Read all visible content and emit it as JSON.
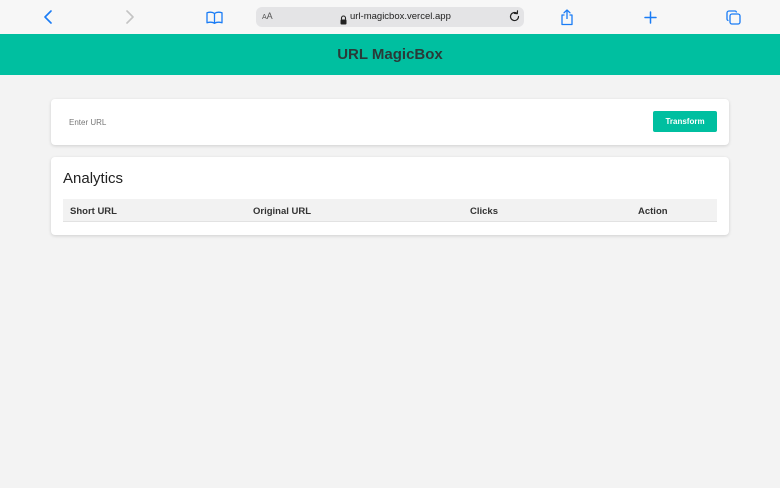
{
  "browser": {
    "aa_label_small": "A",
    "aa_label_large": "A",
    "url": "url-magicbox.vercel.app",
    "icons": [
      "back-icon",
      "forward-icon",
      "bookmarks-icon",
      "lock-icon",
      "reload-icon",
      "share-icon",
      "new-tab-icon",
      "tabs-icon"
    ],
    "accent_color": "#1a7cf5"
  },
  "header": {
    "title": "URL MagicBox",
    "background_color": "#00bfa0"
  },
  "shortener": {
    "input_placeholder": "Enter URL",
    "input_value": "",
    "button_label": "Transform"
  },
  "analytics": {
    "title": "Analytics",
    "columns": [
      "Short URL",
      "Original URL",
      "Clicks",
      "Action"
    ],
    "rows": []
  }
}
